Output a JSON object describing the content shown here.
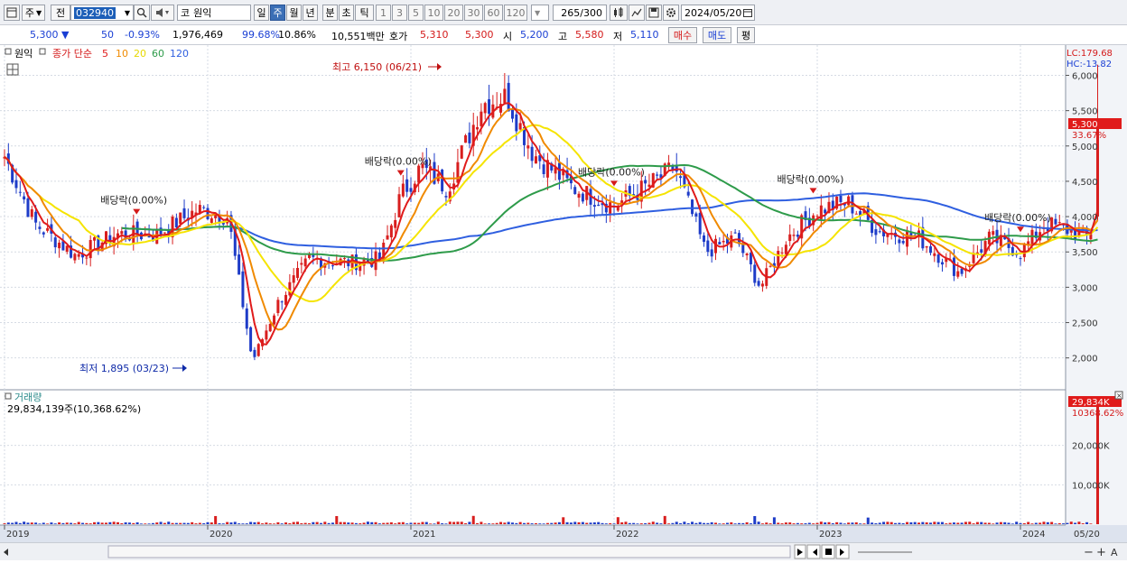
{
  "toolbar": {
    "type_label": "주",
    "prev_label": "전",
    "stock_code": "032940",
    "market_label": "코",
    "stock_name": "원익",
    "periods": [
      "일",
      "주",
      "월",
      "년",
      "분",
      "초",
      "틱"
    ],
    "selected_period": "주",
    "intervals": [
      "1",
      "3",
      "5",
      "10",
      "20",
      "30",
      "60",
      "120"
    ],
    "count": "265",
    "count_max": "/300",
    "date": "2024/05/20"
  },
  "info": {
    "price": "5,300",
    "change": "50",
    "change_pct": "-0.93%",
    "volume": "1,976,469",
    "vol_ratio": "99.68%",
    "turnover": "10.86%",
    "amount": "10,551백만",
    "ask_label": "호가",
    "ask1": "5,310",
    "ask2": "5,300",
    "open_label": "시",
    "open": "5,200",
    "high_label": "고",
    "high": "5,580",
    "low_label": "저",
    "low": "5,110",
    "buy_label": "매수",
    "sell_label": "매도",
    "eval_label": "평"
  },
  "price_panel": {
    "title": "원익",
    "legend_prefix": "종가 단순",
    "ma_labels": [
      "5",
      "10",
      "20",
      "60",
      "120"
    ],
    "ma_colors": [
      "#e01b1b",
      "#f08a00",
      "#f5e400",
      "#2e9b4a",
      "#2f5fe0"
    ],
    "lc": "LC:179.68",
    "hc": "HC:-13.82",
    "current_price": "5,300",
    "current_pct": "33.67%",
    "high_annotation": "최고 6,150 (06/21)",
    "low_annotation": "최저 1,895 (03/23)",
    "dividend_label": "배당락(0.00%)"
  },
  "volume_panel": {
    "title": "거래량",
    "value": "29,834,139주(10,368.62%)",
    "tag": "29,834K",
    "tag_pct": "10368.62%"
  },
  "colors": {
    "up": "#d81e1e",
    "down": "#1e3cc8",
    "grid": "#d6dbe4"
  },
  "chart_data": {
    "type": "candlestick",
    "y_ticks": [
      "6,000",
      "5,500",
      "5,000",
      "4,500",
      "4,000",
      "3,500",
      "3,000",
      "2,500",
      "2,000"
    ],
    "y_values": [
      6000,
      5500,
      5000,
      4500,
      4000,
      3500,
      3000,
      2500,
      2000
    ],
    "ylim": [
      1600,
      6300
    ],
    "vol_ticks": [
      "20,000K",
      "10,000K"
    ],
    "vol_values": [
      20000,
      10000
    ],
    "vol_lim": [
      0,
      30000
    ],
    "x_labels": [
      "2019",
      "2020",
      "2021",
      "2022",
      "2023",
      "2024",
      "05/20"
    ],
    "anchors": [
      [
        2019.0,
        4850
      ],
      [
        2019.15,
        3900
      ],
      [
        2019.35,
        3450
      ],
      [
        2019.55,
        3750
      ],
      [
        2019.75,
        3750
      ],
      [
        2019.95,
        4100
      ],
      [
        2020.1,
        4000
      ],
      [
        2020.22,
        1950
      ],
      [
        2020.35,
        2800
      ],
      [
        2020.5,
        3400
      ],
      [
        2020.7,
        3350
      ],
      [
        2020.85,
        3400
      ],
      [
        2020.95,
        4300
      ],
      [
        2021.05,
        4700
      ],
      [
        2021.18,
        4400
      ],
      [
        2021.35,
        5600
      ],
      [
        2021.47,
        5700
      ],
      [
        2021.6,
        4900
      ],
      [
        2021.8,
        4400
      ],
      [
        2022.0,
        4150
      ],
      [
        2022.2,
        4500
      ],
      [
        2022.3,
        4700
      ],
      [
        2022.45,
        3500
      ],
      [
        2022.6,
        3700
      ],
      [
        2022.72,
        3000
      ],
      [
        2022.85,
        3700
      ],
      [
        2023.0,
        4100
      ],
      [
        2023.15,
        4200
      ],
      [
        2023.3,
        3800
      ],
      [
        2023.5,
        3700
      ],
      [
        2023.7,
        3200
      ],
      [
        2023.85,
        3700
      ],
      [
        2024.0,
        3500
      ],
      [
        2024.12,
        3900
      ],
      [
        2024.25,
        3800
      ],
      [
        2024.33,
        3700
      ],
      [
        2024.38,
        4000
      ]
    ],
    "last_candle": {
      "open": 4000,
      "close": 5300,
      "high": 6150,
      "low": 3950
    },
    "dividend_marks": [
      2019.65,
      2020.95,
      2022.0,
      2022.98,
      2024.0
    ],
    "volume_spike": 29834
  }
}
